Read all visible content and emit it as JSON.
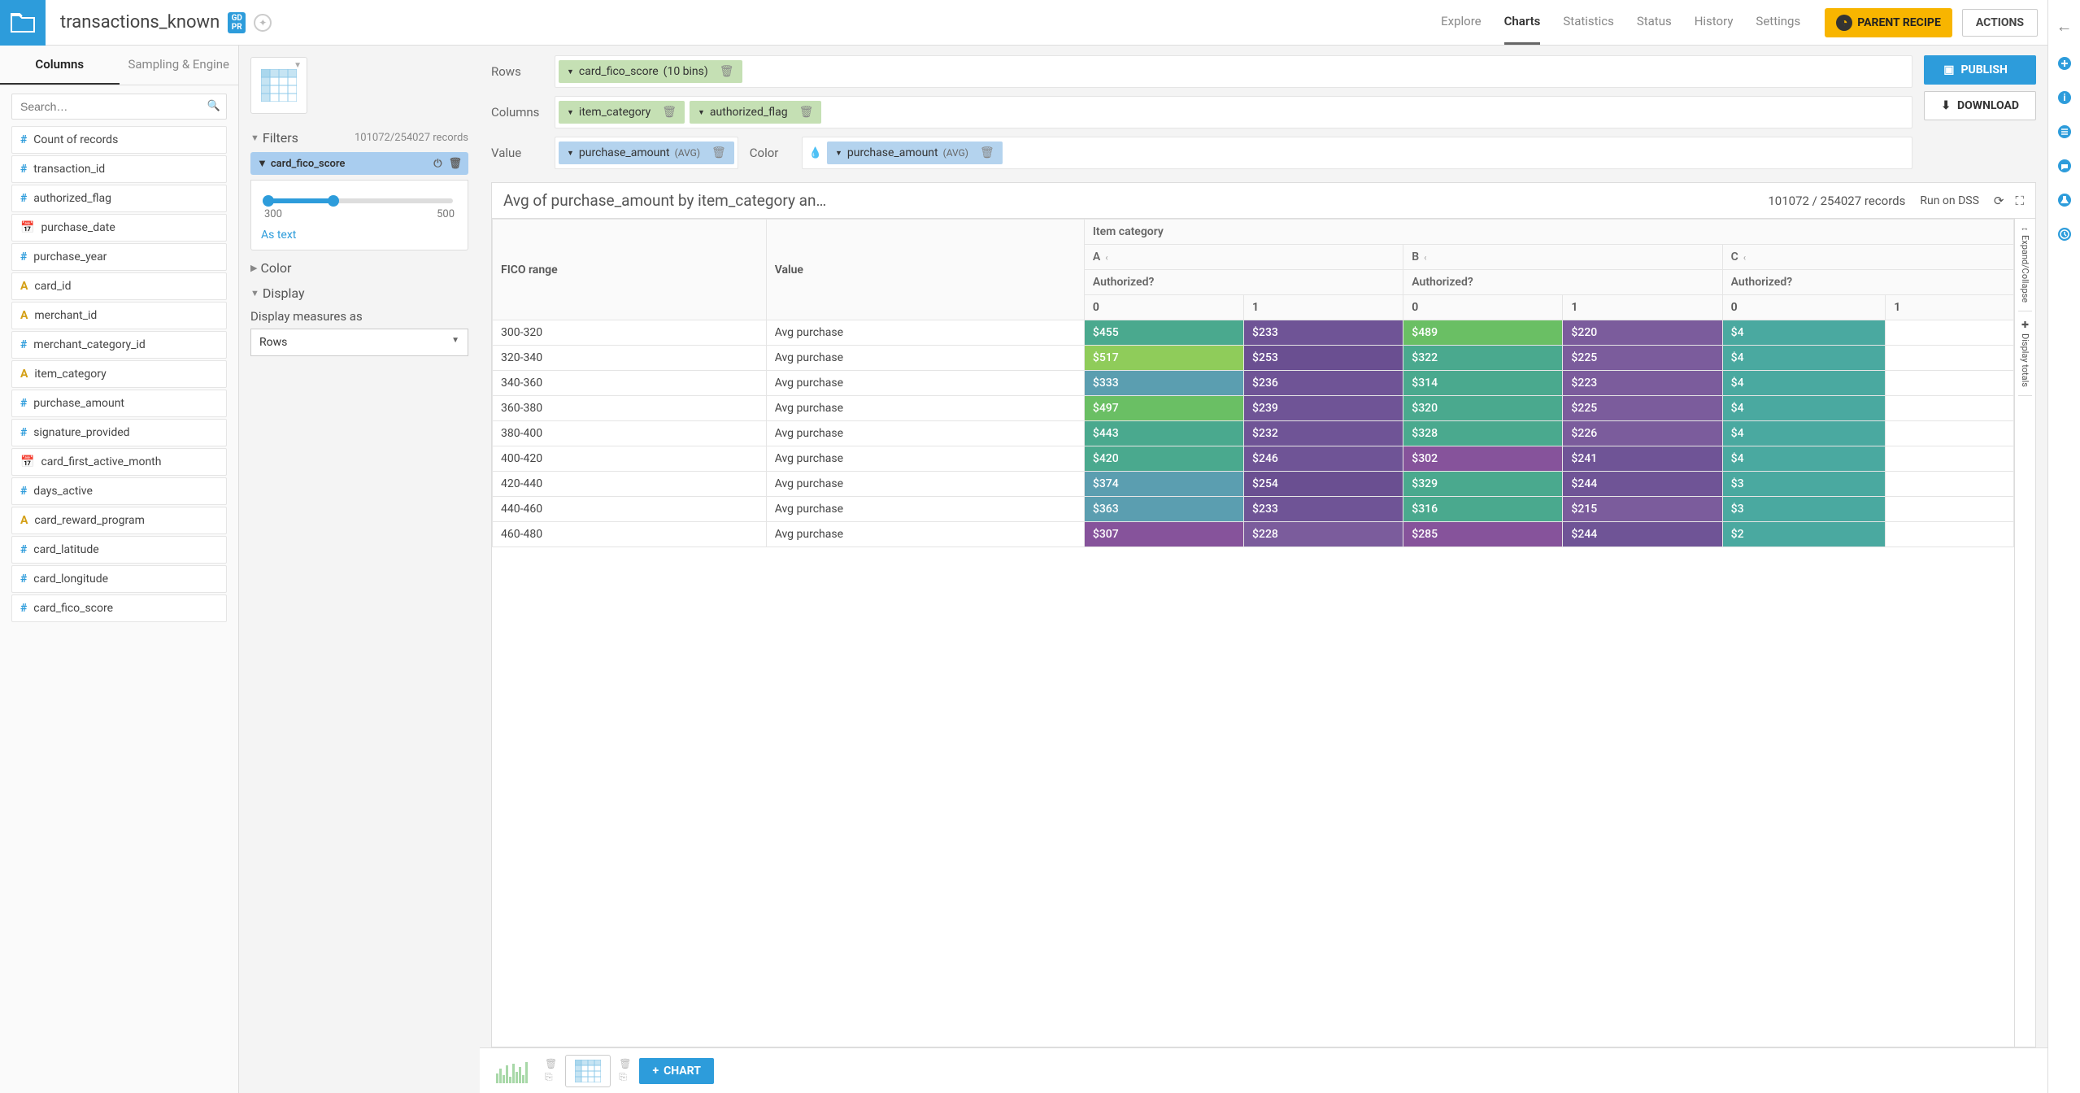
{
  "header": {
    "dataset_name": "transactions_known",
    "gdpr_label": "GD\nPR",
    "tabs": [
      "Explore",
      "Charts",
      "Statistics",
      "Status",
      "History",
      "Settings"
    ],
    "active_tab": "Charts",
    "parent_recipe": "PARENT RECIPE",
    "actions": "ACTIONS"
  },
  "sidebar": {
    "tabs": [
      "Columns",
      "Sampling & Engine"
    ],
    "active_tab": "Columns",
    "search_placeholder": "Search…",
    "columns": [
      {
        "type": "num",
        "name": "Count of records"
      },
      {
        "type": "num",
        "name": "transaction_id"
      },
      {
        "type": "num",
        "name": "authorized_flag"
      },
      {
        "type": "date",
        "name": "purchase_date"
      },
      {
        "type": "num",
        "name": "purchase_year"
      },
      {
        "type": "text",
        "name": "card_id"
      },
      {
        "type": "text",
        "name": "merchant_id"
      },
      {
        "type": "num",
        "name": "merchant_category_id"
      },
      {
        "type": "text",
        "name": "item_category"
      },
      {
        "type": "num",
        "name": "purchase_amount"
      },
      {
        "type": "num",
        "name": "signature_provided"
      },
      {
        "type": "date",
        "name": "card_first_active_month"
      },
      {
        "type": "num",
        "name": "days_active"
      },
      {
        "type": "text",
        "name": "card_reward_program"
      },
      {
        "type": "num",
        "name": "card_latitude"
      },
      {
        "type": "num",
        "name": "card_longitude"
      },
      {
        "type": "num",
        "name": "card_fico_score"
      }
    ]
  },
  "config": {
    "filters_label": "Filters",
    "records_count": "101072/254027 records",
    "filter_field": "card_fico_score",
    "slider_min": "300",
    "slider_max": "500",
    "as_text": "As text",
    "color_section": "Color",
    "display_section": "Display",
    "display_measures_label": "Display measures as",
    "display_measures_value": "Rows"
  },
  "chart_builder": {
    "rows_label": "Rows",
    "columns_label": "Columns",
    "value_label": "Value",
    "color_label": "Color",
    "rows_chips": [
      {
        "name": "card_fico_score",
        "extra": "(10 bins)"
      }
    ],
    "columns_chips": [
      {
        "name": "item_category"
      },
      {
        "name": "authorized_flag"
      }
    ],
    "value_chips": [
      {
        "name": "purchase_amount",
        "agg": "(AVG)"
      }
    ],
    "color_chips": [
      {
        "name": "purchase_amount",
        "agg": "(AVG)"
      }
    ],
    "publish": "PUBLISH",
    "download": "DOWNLOAD"
  },
  "pivot": {
    "title": "Avg of purchase_amount by item_category an…",
    "records": "101072 / 254027 records",
    "run_on": "Run on DSS",
    "col_group_label": "Item category",
    "col_groups": [
      "A",
      "B",
      "C"
    ],
    "sub_label": "Authorized?",
    "sub_cols": [
      "0",
      "1"
    ],
    "row_group_label": "FICO range",
    "value_label": "Value",
    "value_name": "Avg purchase",
    "expand_collapse": "Expand/Collapse",
    "display_totals": "Display totals"
  },
  "chart_data": {
    "type": "table",
    "row_label": "FICO range",
    "col_group_label": "Item category",
    "sub_col_label": "Authorized?",
    "col_groups": [
      "A",
      "B",
      "C"
    ],
    "sub_cols": [
      "0",
      "1"
    ],
    "rows": [
      {
        "bin": "300-320",
        "values": {
          "A": {
            "0": 455,
            "1": 233
          },
          "B": {
            "0": 489,
            "1": 220
          },
          "C": {
            "0": 4
          }
        }
      },
      {
        "bin": "320-340",
        "values": {
          "A": {
            "0": 517,
            "1": 253
          },
          "B": {
            "0": 322,
            "1": 225
          },
          "C": {
            "0": 4
          }
        }
      },
      {
        "bin": "340-360",
        "values": {
          "A": {
            "0": 333,
            "1": 236
          },
          "B": {
            "0": 314,
            "1": 223
          },
          "C": {
            "0": 4
          }
        }
      },
      {
        "bin": "360-380",
        "values": {
          "A": {
            "0": 497,
            "1": 239
          },
          "B": {
            "0": 320,
            "1": 225
          },
          "C": {
            "0": 4
          }
        }
      },
      {
        "bin": "380-400",
        "values": {
          "A": {
            "0": 443,
            "1": 232
          },
          "B": {
            "0": 328,
            "1": 226
          },
          "C": {
            "0": 4
          }
        }
      },
      {
        "bin": "400-420",
        "values": {
          "A": {
            "0": 420,
            "1": 246
          },
          "B": {
            "0": 302,
            "1": 241
          },
          "C": {
            "0": 4
          }
        }
      },
      {
        "bin": "420-440",
        "values": {
          "A": {
            "0": 374,
            "1": 254
          },
          "B": {
            "0": 329,
            "1": 244
          },
          "C": {
            "0": 3
          }
        }
      },
      {
        "bin": "440-460",
        "values": {
          "A": {
            "0": 363,
            "1": 233
          },
          "B": {
            "0": 316,
            "1": 215
          },
          "C": {
            "0": 3
          }
        }
      },
      {
        "bin": "460-480",
        "values": {
          "A": {
            "0": 307,
            "1": 228
          },
          "B": {
            "0": 285,
            "1": 244
          },
          "C": {
            "0": 2
          }
        }
      }
    ]
  },
  "bottom": {
    "add_chart": "CHART"
  }
}
